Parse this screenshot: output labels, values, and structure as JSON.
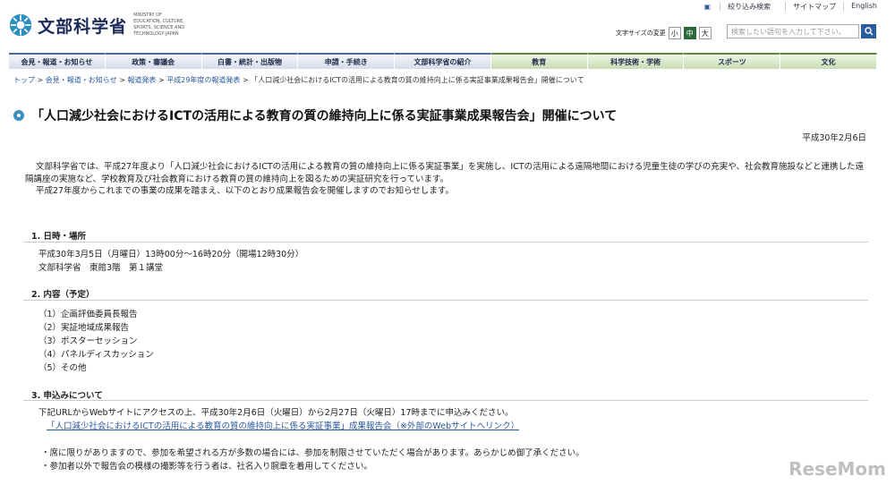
{
  "header": {
    "logo_ja": "文部科学省",
    "logo_en": "MINISTRY OF EDUCATION, CULTURE, SPORTS, SCIENCE AND TECHNOLOGY-JAPAN",
    "util_links": [
      "絞り込み検索",
      "サイトマップ",
      "English"
    ],
    "font_size_label": "文字サイズの変更",
    "font_sizes": [
      "小",
      "中",
      "大"
    ],
    "search_placeholder": "検索したい語句を入力して下さい。"
  },
  "nav": {
    "items": [
      "会見・報道・お知らせ",
      "政策・審議会",
      "白書・統計・出版物",
      "申請・手続き",
      "文部科学省の紹介",
      "教育",
      "科学技術・学術",
      "スポーツ",
      "文化"
    ]
  },
  "breadcrumb": {
    "items": [
      "トップ",
      "会見・報道・お知らせ",
      "報道発表",
      "平成29年度の報道発表"
    ],
    "current": "「人口減少社会におけるICTの活用による教育の質の維持向上に係る実証事業成果報告会」開催について",
    "sep": ">"
  },
  "page": {
    "title": "「人口減少社会におけるICTの活用による教育の質の維持向上に係る実証事業成果報告会」開催について",
    "date": "平成30年2月6日",
    "intro_1": "文部科学省では、平成27年度より「人口減少社会におけるICTの活用による教育の質の維持向上に係る実証事業」を実施し、ICTの活用による遠隔地間における児童生徒の学びの充実や、社会教育施設などと連携した遠隔講座の実施など、学校教育及び社会教育における教育の質の維持向上を図るための実証研究を行っています。",
    "intro_2": "平成27年度からこれまでの事業の成果を踏まえ、以下のとおり成果報告会を開催しますのでお知らせします。"
  },
  "sections": {
    "s1_title": "1.  日時・場所",
    "s1_line1": "平成30年3月5日（月曜日）13時00分～16時20分（開場12時30分）",
    "s1_line2": "文部科学省　東館3階　第１講堂",
    "s2_title": "2.  内容（予定）",
    "s2_items": [
      "（1）企画評価委員長報告",
      "（2）実証地域成果報告",
      "（3）ポスターセッション",
      "（4）パネルディスカッション",
      "（5）その他"
    ],
    "s3_title": "3.  申込みについて",
    "s3_line1": "下記URLからWebサイトにアクセスの上、平成30年2月6日（火曜日）から2月27日（火曜日）17時までに申込みください。",
    "s3_link": "「人口減少社会におけるICTの活用による教育の質の維持向上に係る実証事業」成果報告会（※外部のWebサイトへリンク）",
    "s3_note1": "・席に限りがありますので、参加を希望される方が多数の場合には、参加を制限させていただく場合があります。あらかじめ御了承ください。",
    "s3_note2": "・参加者以外で報告会の模様の撮影等を行う者は、社名入り腕章を着用してください。"
  },
  "watermark": "ReseMom"
}
